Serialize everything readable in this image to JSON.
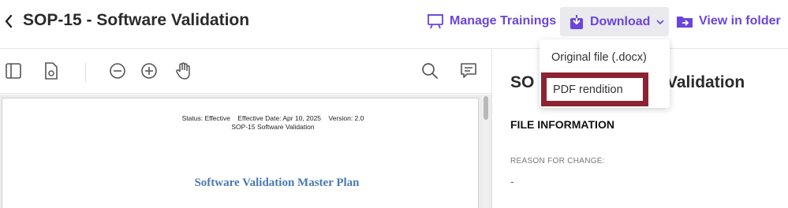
{
  "header": {
    "title": "SOP-15 - Software Validation",
    "manage_label": "Manage Trainings",
    "download_label": "Download",
    "view_folder_label": "View in folder"
  },
  "download_menu": {
    "items": [
      "Original file (.docx)",
      "PDF rendition"
    ]
  },
  "document": {
    "status_line": "Status: Effective    Effective Date: Apr 10, 2025    Version: 2.0",
    "subtitle": "SOP-15 Software Validation",
    "heading": "Software Validation Master Plan"
  },
  "details": {
    "title_start": "SO",
    "title_end": "Validation",
    "section_title": "FILE INFORMATION",
    "reason_label": "REASON FOR CHANGE:",
    "reason_value": "-"
  },
  "colors": {
    "accent": "#6b45d8",
    "highlight_border": "#8b2332",
    "doc_heading": "#4a79b3"
  }
}
